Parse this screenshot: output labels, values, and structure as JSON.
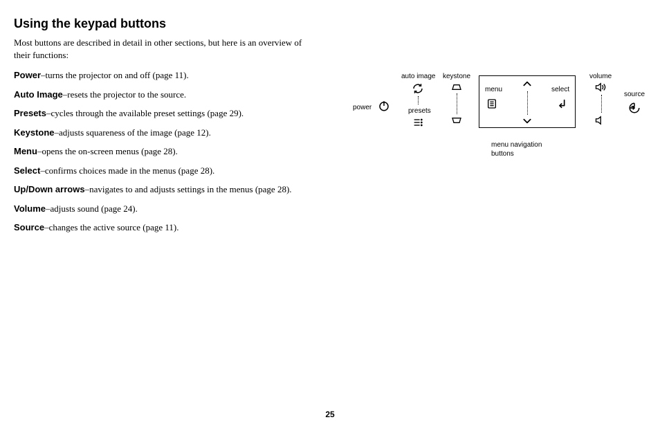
{
  "title": "Using the keypad buttons",
  "intro": "Most buttons are described in detail in other sections, but here is an overview of their functions:",
  "items": [
    {
      "term": "Power",
      "desc": "–turns the projector on and off (page 11)."
    },
    {
      "term": "Auto Image",
      "desc": "–resets the projector to the source."
    },
    {
      "term": "Presets",
      "desc": "–cycles through the available preset settings (page 29)."
    },
    {
      "term": "Keystone",
      "desc": "–adjusts squareness of the image (page 12)."
    },
    {
      "term": "Menu",
      "desc": "–opens the on-screen menus (page 28)."
    },
    {
      "term": "Select",
      "desc": "–confirms choices made in the menus (page 28)."
    },
    {
      "term": "Up/Down arrows",
      "desc": "–navigates to and adjusts settings in the menus (page 28)."
    },
    {
      "term": "Volume",
      "desc": "–adjusts sound (page 24)."
    },
    {
      "term": "Source",
      "desc": "–changes the active source (page 11)."
    }
  ],
  "page_number": "25",
  "diagram": {
    "labels": {
      "power": "power",
      "auto_image": "auto image",
      "presets": "presets",
      "keystone": "keystone",
      "menu": "menu",
      "select": "select",
      "volume": "volume",
      "source": "source",
      "nav_caption": "menu navigation buttons"
    }
  }
}
